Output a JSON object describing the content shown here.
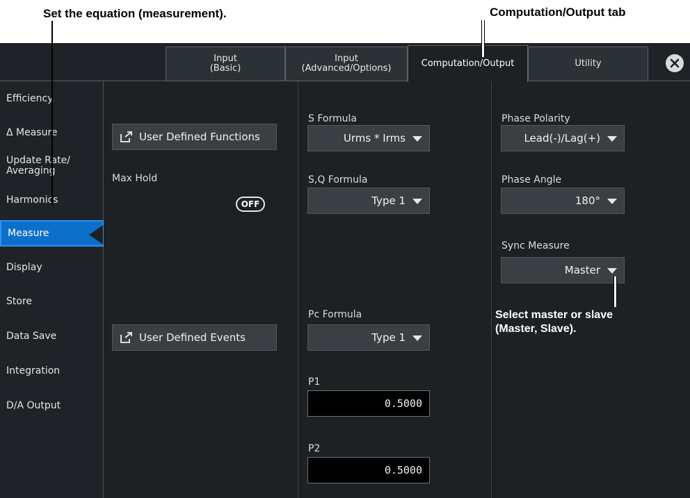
{
  "annotations": {
    "equation": "Set the equation (measurement).",
    "tab": "Computation/Output tab",
    "sync_line1": "Select master or slave",
    "sync_line2": "(Master, Slave)."
  },
  "tabs": [
    {
      "label": "Input\n(Basic)",
      "active": false
    },
    {
      "label": "Input\n(Advanced/Options)",
      "active": false
    },
    {
      "label": "Computation/Output",
      "active": true
    },
    {
      "label": "Utility",
      "active": false
    }
  ],
  "close_icon": "close-icon",
  "sidebar": {
    "items": [
      {
        "label": "Efficiency"
      },
      {
        "label": "Δ Measure"
      },
      {
        "label": "Update Rate/\nAveraging"
      },
      {
        "label": "Harmonics"
      },
      {
        "label": "Measure",
        "active": true
      },
      {
        "label": "Display"
      },
      {
        "label": "Store"
      },
      {
        "label": "Data Save"
      },
      {
        "label": "Integration"
      },
      {
        "label": "D/A Output"
      }
    ]
  },
  "left_panel": {
    "user_defined_functions": "User Defined Functions",
    "max_hold_label": "Max Hold",
    "max_hold_value": "OFF",
    "user_defined_events": "User Defined Events"
  },
  "middle_panel": {
    "s_formula_label": "S Formula",
    "s_formula_value": "Urms * Irms",
    "sq_formula_label": "S,Q Formula",
    "sq_formula_value": "Type 1",
    "pc_formula_label": "Pc Formula",
    "pc_formula_value": "Type 1",
    "p1_label": "P1",
    "p1_value": "0.5000",
    "p2_label": "P2",
    "p2_value": "0.5000"
  },
  "right_panel": {
    "phase_polarity_label": "Phase Polarity",
    "phase_polarity_value": "Lead(-)/Lag(+)",
    "phase_angle_label": "Phase Angle",
    "phase_angle_value": "180°",
    "sync_measure_label": "Sync Measure",
    "sync_measure_value": "Master"
  },
  "colors": {
    "background": "#1d2124",
    "active_item": "#0c6fc9",
    "control": "#3a3f44"
  }
}
